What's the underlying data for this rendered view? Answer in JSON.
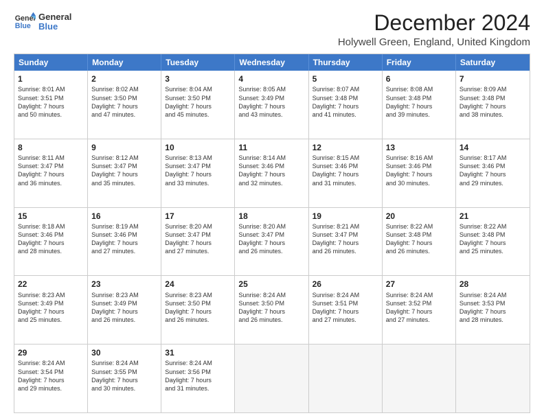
{
  "header": {
    "logo_line1": "General",
    "logo_line2": "Blue",
    "title": "December 2024",
    "subtitle": "Holywell Green, England, United Kingdom"
  },
  "calendar": {
    "days_of_week": [
      "Sunday",
      "Monday",
      "Tuesday",
      "Wednesday",
      "Thursday",
      "Friday",
      "Saturday"
    ],
    "weeks": [
      [
        {
          "day": "1",
          "lines": [
            "Sunrise: 8:01 AM",
            "Sunset: 3:51 PM",
            "Daylight: 7 hours",
            "and 50 minutes."
          ]
        },
        {
          "day": "2",
          "lines": [
            "Sunrise: 8:02 AM",
            "Sunset: 3:50 PM",
            "Daylight: 7 hours",
            "and 47 minutes."
          ]
        },
        {
          "day": "3",
          "lines": [
            "Sunrise: 8:04 AM",
            "Sunset: 3:50 PM",
            "Daylight: 7 hours",
            "and 45 minutes."
          ]
        },
        {
          "day": "4",
          "lines": [
            "Sunrise: 8:05 AM",
            "Sunset: 3:49 PM",
            "Daylight: 7 hours",
            "and 43 minutes."
          ]
        },
        {
          "day": "5",
          "lines": [
            "Sunrise: 8:07 AM",
            "Sunset: 3:48 PM",
            "Daylight: 7 hours",
            "and 41 minutes."
          ]
        },
        {
          "day": "6",
          "lines": [
            "Sunrise: 8:08 AM",
            "Sunset: 3:48 PM",
            "Daylight: 7 hours",
            "and 39 minutes."
          ]
        },
        {
          "day": "7",
          "lines": [
            "Sunrise: 8:09 AM",
            "Sunset: 3:48 PM",
            "Daylight: 7 hours",
            "and 38 minutes."
          ]
        }
      ],
      [
        {
          "day": "8",
          "lines": [
            "Sunrise: 8:11 AM",
            "Sunset: 3:47 PM",
            "Daylight: 7 hours",
            "and 36 minutes."
          ]
        },
        {
          "day": "9",
          "lines": [
            "Sunrise: 8:12 AM",
            "Sunset: 3:47 PM",
            "Daylight: 7 hours",
            "and 35 minutes."
          ]
        },
        {
          "day": "10",
          "lines": [
            "Sunrise: 8:13 AM",
            "Sunset: 3:47 PM",
            "Daylight: 7 hours",
            "and 33 minutes."
          ]
        },
        {
          "day": "11",
          "lines": [
            "Sunrise: 8:14 AM",
            "Sunset: 3:46 PM",
            "Daylight: 7 hours",
            "and 32 minutes."
          ]
        },
        {
          "day": "12",
          "lines": [
            "Sunrise: 8:15 AM",
            "Sunset: 3:46 PM",
            "Daylight: 7 hours",
            "and 31 minutes."
          ]
        },
        {
          "day": "13",
          "lines": [
            "Sunrise: 8:16 AM",
            "Sunset: 3:46 PM",
            "Daylight: 7 hours",
            "and 30 minutes."
          ]
        },
        {
          "day": "14",
          "lines": [
            "Sunrise: 8:17 AM",
            "Sunset: 3:46 PM",
            "Daylight: 7 hours",
            "and 29 minutes."
          ]
        }
      ],
      [
        {
          "day": "15",
          "lines": [
            "Sunrise: 8:18 AM",
            "Sunset: 3:46 PM",
            "Daylight: 7 hours",
            "and 28 minutes."
          ]
        },
        {
          "day": "16",
          "lines": [
            "Sunrise: 8:19 AM",
            "Sunset: 3:46 PM",
            "Daylight: 7 hours",
            "and 27 minutes."
          ]
        },
        {
          "day": "17",
          "lines": [
            "Sunrise: 8:20 AM",
            "Sunset: 3:47 PM",
            "Daylight: 7 hours",
            "and 27 minutes."
          ]
        },
        {
          "day": "18",
          "lines": [
            "Sunrise: 8:20 AM",
            "Sunset: 3:47 PM",
            "Daylight: 7 hours",
            "and 26 minutes."
          ]
        },
        {
          "day": "19",
          "lines": [
            "Sunrise: 8:21 AM",
            "Sunset: 3:47 PM",
            "Daylight: 7 hours",
            "and 26 minutes."
          ]
        },
        {
          "day": "20",
          "lines": [
            "Sunrise: 8:22 AM",
            "Sunset: 3:48 PM",
            "Daylight: 7 hours",
            "and 26 minutes."
          ]
        },
        {
          "day": "21",
          "lines": [
            "Sunrise: 8:22 AM",
            "Sunset: 3:48 PM",
            "Daylight: 7 hours",
            "and 25 minutes."
          ]
        }
      ],
      [
        {
          "day": "22",
          "lines": [
            "Sunrise: 8:23 AM",
            "Sunset: 3:49 PM",
            "Daylight: 7 hours",
            "and 25 minutes."
          ]
        },
        {
          "day": "23",
          "lines": [
            "Sunrise: 8:23 AM",
            "Sunset: 3:49 PM",
            "Daylight: 7 hours",
            "and 26 minutes."
          ]
        },
        {
          "day": "24",
          "lines": [
            "Sunrise: 8:23 AM",
            "Sunset: 3:50 PM",
            "Daylight: 7 hours",
            "and 26 minutes."
          ]
        },
        {
          "day": "25",
          "lines": [
            "Sunrise: 8:24 AM",
            "Sunset: 3:50 PM",
            "Daylight: 7 hours",
            "and 26 minutes."
          ]
        },
        {
          "day": "26",
          "lines": [
            "Sunrise: 8:24 AM",
            "Sunset: 3:51 PM",
            "Daylight: 7 hours",
            "and 27 minutes."
          ]
        },
        {
          "day": "27",
          "lines": [
            "Sunrise: 8:24 AM",
            "Sunset: 3:52 PM",
            "Daylight: 7 hours",
            "and 27 minutes."
          ]
        },
        {
          "day": "28",
          "lines": [
            "Sunrise: 8:24 AM",
            "Sunset: 3:53 PM",
            "Daylight: 7 hours",
            "and 28 minutes."
          ]
        }
      ],
      [
        {
          "day": "29",
          "lines": [
            "Sunrise: 8:24 AM",
            "Sunset: 3:54 PM",
            "Daylight: 7 hours",
            "and 29 minutes."
          ]
        },
        {
          "day": "30",
          "lines": [
            "Sunrise: 8:24 AM",
            "Sunset: 3:55 PM",
            "Daylight: 7 hours",
            "and 30 minutes."
          ]
        },
        {
          "day": "31",
          "lines": [
            "Sunrise: 8:24 AM",
            "Sunset: 3:56 PM",
            "Daylight: 7 hours",
            "and 31 minutes."
          ]
        },
        {
          "day": "",
          "lines": []
        },
        {
          "day": "",
          "lines": []
        },
        {
          "day": "",
          "lines": []
        },
        {
          "day": "",
          "lines": []
        }
      ]
    ]
  }
}
